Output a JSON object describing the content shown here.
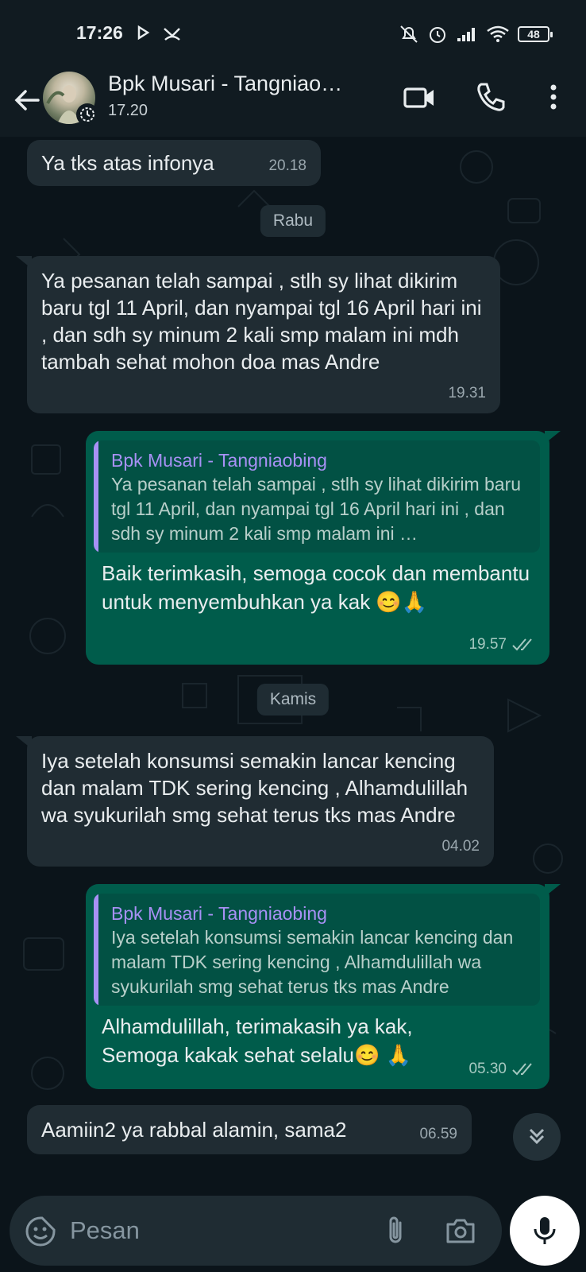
{
  "status_bar": {
    "time": "17:26",
    "battery": "48"
  },
  "header": {
    "contact_name": "Bpk Musari - Tangniao…",
    "status": "17.20"
  },
  "messages": [
    {
      "type": "in",
      "text": "Ya tks atas infonya",
      "time": "20.18"
    },
    {
      "type": "day",
      "label": "Rabu"
    },
    {
      "type": "in",
      "text": "Ya pesanan telah sampai , stlh sy lihat dikirim baru tgl 11 April, dan nyampai tgl 16 April hari ini , dan sdh sy minum 2 kali smp malam ini mdh tambah sehat mohon doa mas Andre",
      "time": "19.31"
    },
    {
      "type": "out",
      "quote_author": "Bpk Musari - Tangniaobing",
      "quote_text": "Ya pesanan telah sampai , stlh sy lihat dikirim baru tgl 11 April, dan nyampai tgl 16 April hari ini , dan sdh sy minum 2 kali smp malam ini …",
      "text": "Baik terimkasih, semoga cocok dan membantu untuk menyembuhkan ya kak 😊🙏",
      "time": "19.57"
    },
    {
      "type": "day",
      "label": "Kamis"
    },
    {
      "type": "in",
      "text": "Iya setelah konsumsi semakin lancar kencing dan malam TDK sering kencing , Alhamdulillah wa syukurilah smg sehat terus tks mas Andre",
      "time": "04.02"
    },
    {
      "type": "out",
      "quote_author": "Bpk Musari - Tangniaobing",
      "quote_text": "Iya setelah konsumsi semakin lancar kencing dan malam TDK sering kencing , Alhamdulillah wa syukurilah smg sehat terus tks mas Andre",
      "text": "Alhamdulillah, terimakasih ya kak, Semoga kakak sehat selalu😊 🙏",
      "time": "05.30"
    },
    {
      "type": "in",
      "text": "Aamiin2 ya rabbal alamin, sama2",
      "time": "06.59"
    }
  ],
  "input": {
    "placeholder": "Pesan"
  },
  "colors": {
    "background": "#0b141a",
    "incoming_bubble": "#202c33",
    "outgoing_bubble": "#005c4b",
    "quote_bar": "#a791f5",
    "header": "#111b21"
  },
  "icons": [
    "back-arrow-icon",
    "video-call-icon",
    "phone-icon",
    "more-vert-icon",
    "emoji-icon",
    "attach-icon",
    "camera-icon",
    "mic-icon",
    "chevron-double-down-icon",
    "double-check-icon"
  ]
}
